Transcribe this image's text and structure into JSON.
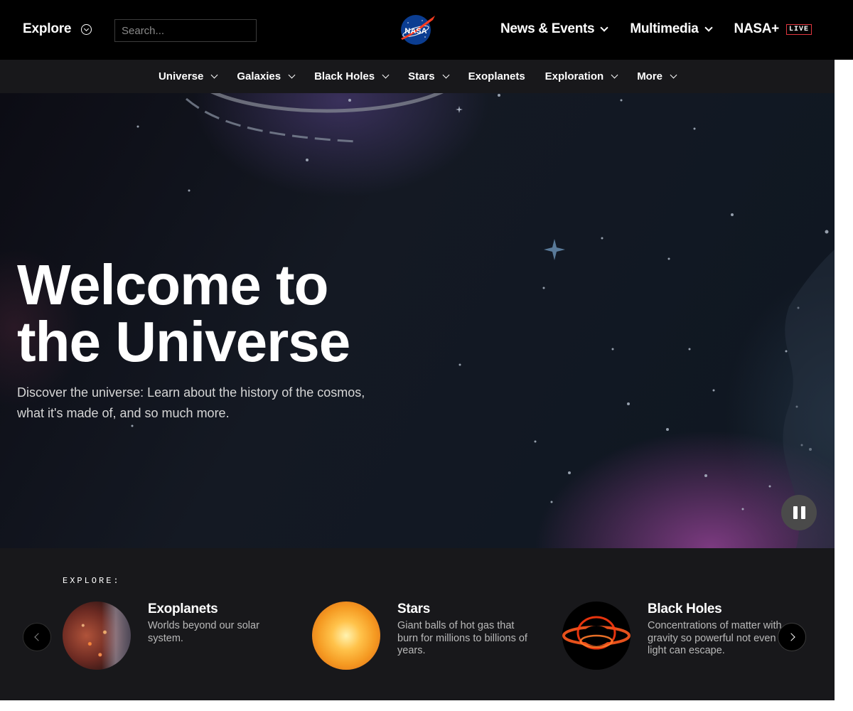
{
  "topbar": {
    "explore_label": "Explore",
    "search_placeholder": "Search...",
    "logo_text": "NASA",
    "nav": [
      {
        "label": "News & Events"
      },
      {
        "label": "Multimedia"
      },
      {
        "label": "NASA+",
        "badge": "LIVE"
      }
    ]
  },
  "subnav": {
    "items": [
      {
        "label": "Universe",
        "has_dropdown": true
      },
      {
        "label": "Galaxies",
        "has_dropdown": true
      },
      {
        "label": "Black Holes",
        "has_dropdown": true
      },
      {
        "label": "Stars",
        "has_dropdown": true
      },
      {
        "label": "Exoplanets",
        "has_dropdown": false
      },
      {
        "label": "Exploration",
        "has_dropdown": true
      },
      {
        "label": "More",
        "has_dropdown": true
      }
    ]
  },
  "hero": {
    "title_line1": "Welcome to",
    "title_line2": "the Universe",
    "description": "Discover the universe: Learn about the history of the cosmos, what it's made of, and so much more."
  },
  "explore": {
    "kicker": "EXPLORE:",
    "cards": [
      {
        "title": "Exoplanets",
        "description": "Worlds beyond our solar system.",
        "icon": "exoplanet-image"
      },
      {
        "title": "Stars",
        "description": "Giant balls of hot gas that burn for millions to billions of years.",
        "icon": "star-image"
      },
      {
        "title": "Black Holes",
        "description": "Concentrations of matter with gravity so powerful not even light can escape.",
        "icon": "black-hole-image"
      }
    ]
  },
  "colors": {
    "topbar_bg": "#000000",
    "subnav_bg": "#18181b",
    "live_badge_border": "#e1373f",
    "nasa_blue": "#0b3d91",
    "nasa_red": "#fc3d21"
  }
}
